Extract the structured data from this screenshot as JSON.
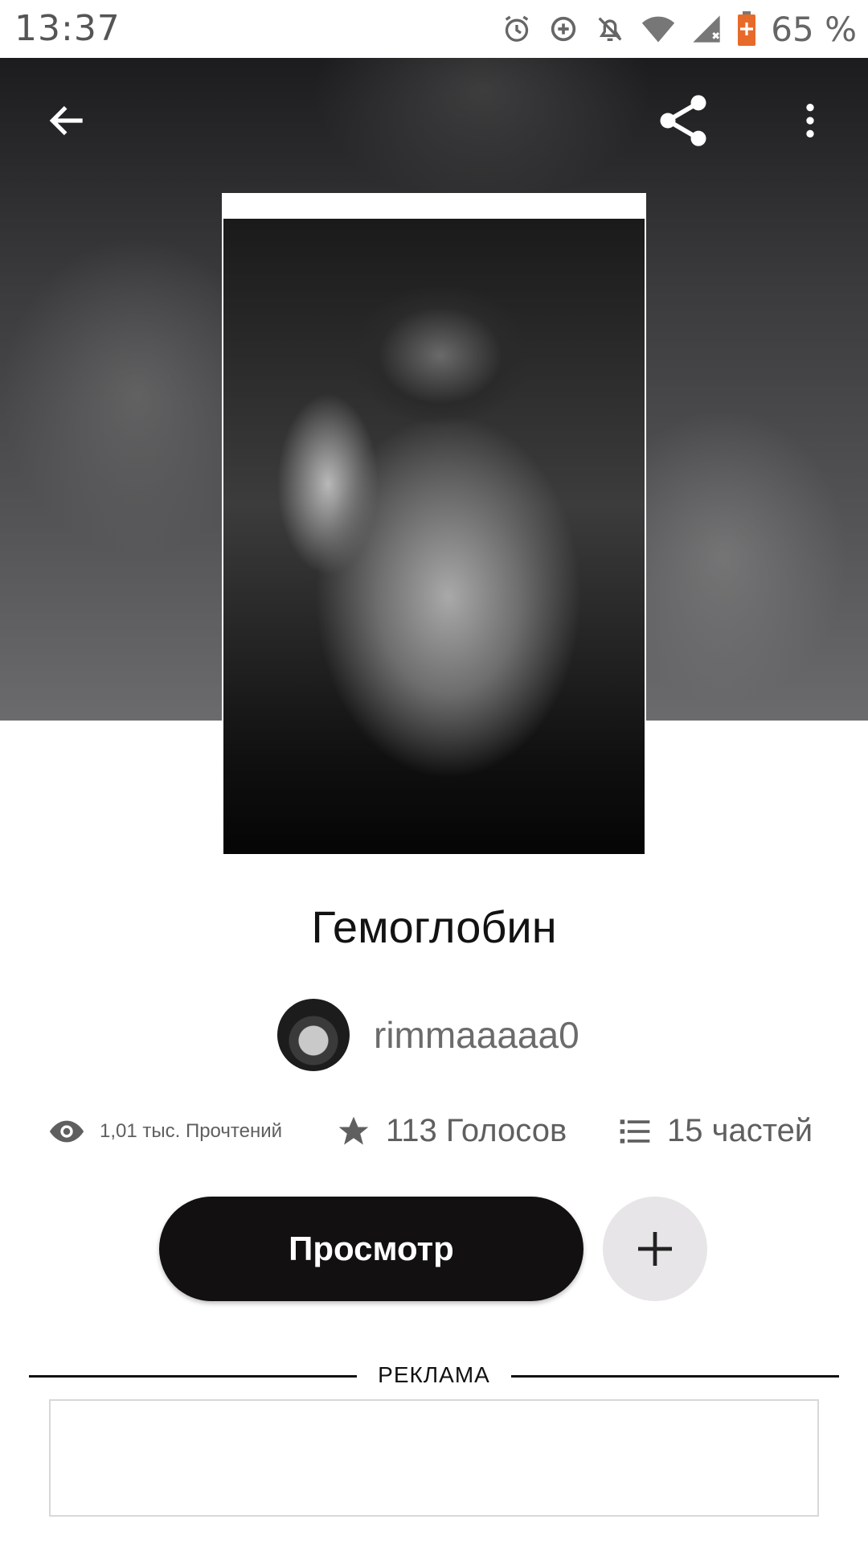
{
  "status_bar": {
    "time": "13:37",
    "battery": "65 %",
    "icons": [
      "alarm-icon",
      "data-saver-icon",
      "mute-icon",
      "wifi-icon",
      "signal-icon",
      "battery-icon"
    ]
  },
  "toolbar": {
    "back_icon": "arrow-back-icon",
    "share_icon": "share-icon",
    "more_icon": "more-vert-icon"
  },
  "story": {
    "title": "Гемоглобин",
    "author": "rimmaaaaa0",
    "reads": "1,01 тыс. Прочтений",
    "votes": "113 Голосов",
    "parts": "15 частей"
  },
  "actions": {
    "read_label": "Просмотр",
    "add_icon": "plus-icon"
  },
  "ad": {
    "label": "РЕКЛАМА"
  },
  "colors": {
    "primary_button": "#121011",
    "add_button_bg": "#e7e5e7",
    "stat_text": "#5f5f5f"
  }
}
